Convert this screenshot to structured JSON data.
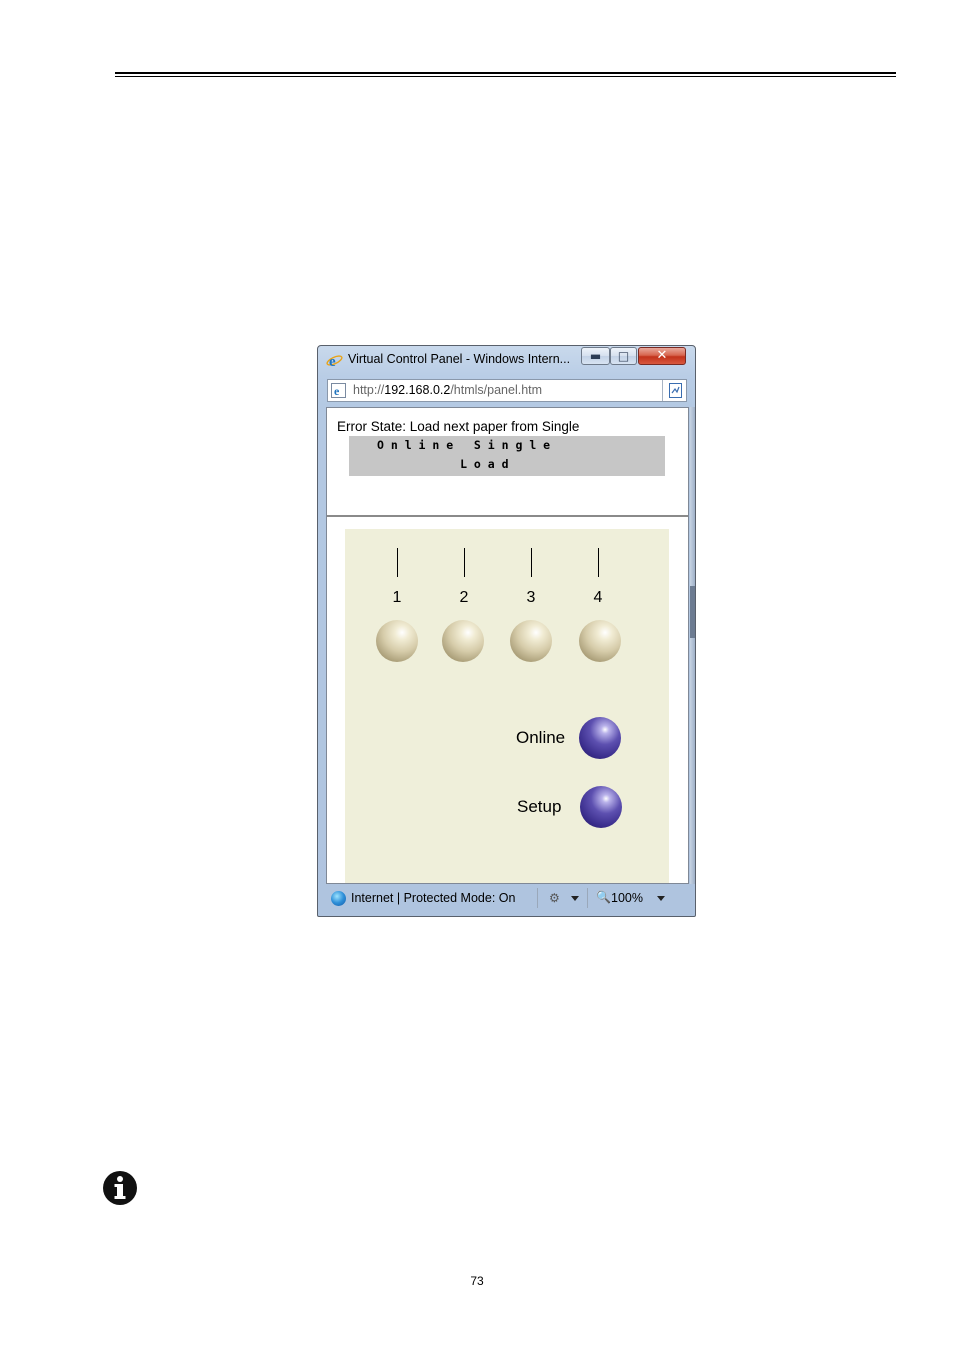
{
  "window": {
    "title": "Virtual Control Panel - Windows Intern...",
    "buttons": {
      "minimize": "minimize",
      "maximize": "maximize",
      "close": "close"
    }
  },
  "address_bar": {
    "scheme": "http://",
    "host": "192.168.0.2",
    "path": "/htmls/panel.htm"
  },
  "display": {
    "error_state": "Error State: Load next paper from Single",
    "lcd_line1": "O n l i n e   S i n g l e",
    "lcd_line2": "            L o a d"
  },
  "panel": {
    "leds": [
      "1",
      "2",
      "3",
      "4"
    ],
    "buttons": [
      {
        "label": "Online",
        "color": "#3a2d8c"
      },
      {
        "label": "Setup",
        "color": "#3a2d8c"
      }
    ],
    "background": "#efefda"
  },
  "status_bar": {
    "zone": "Internet | Protected Mode: On",
    "zoom": "100%"
  },
  "page": {
    "number": "73"
  }
}
